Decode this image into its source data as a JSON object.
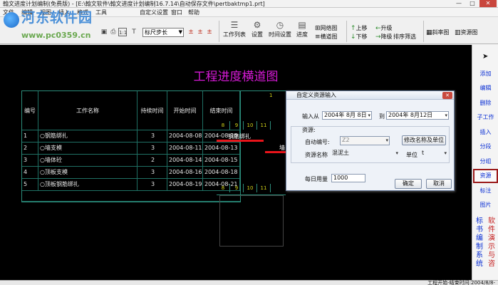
{
  "window": {
    "title": "翰文进度计划编制(免费版) - [E:\\翰文软件\\翰文进度计划编制16.7.14\\自动保存文件\\pertbaktmp1.prt]",
    "minimize_glyph": "—",
    "maximize_glyph": "□",
    "close_glyph": "✕"
  },
  "menu": {
    "items": [
      "文件",
      "编辑",
      "视图",
      "插入",
      "格式",
      "工具",
      "自定义设置",
      "窗口",
      "帮助"
    ]
  },
  "watermark": {
    "name": "河东软件园",
    "url": "www.pc0359.cn"
  },
  "toolbar": {
    "zoom_value": "1:1",
    "ruler_select": "标尺步长",
    "buttons": {
      "work_list": "工作列表",
      "settings": "设置",
      "time_settings": "时间设置",
      "progress": "进度",
      "network_chart": "网络图",
      "bar_chart": "横道图",
      "move_up": "上移",
      "upgrade": "升级",
      "move_down": "下移",
      "downgrade": "降级",
      "sort_filter": "排序筛选",
      "bank_chart": "斜率图",
      "resource_chart": "资源图"
    }
  },
  "chart": {
    "title": "工程进度横道图",
    "columns": [
      "编号",
      "工作名称",
      "持续时间",
      "开始时间",
      "结束时间"
    ],
    "rows": [
      {
        "id": "1",
        "name": "○钢筋绑扎",
        "duration": "3",
        "start": "2004-08-08",
        "end": "2004-08-10"
      },
      {
        "id": "2",
        "name": "○墙支模",
        "duration": "3",
        "start": "2004-08-11",
        "end": "2004-08-13"
      },
      {
        "id": "3",
        "name": "○墙体砼",
        "duration": "2",
        "start": "2004-08-14",
        "end": "2004-08-15"
      },
      {
        "id": "4",
        "name": "○顶板支模",
        "duration": "3",
        "start": "2004-08-16",
        "end": "2004-08-18"
      },
      {
        "id": "5",
        "name": "○顶板钢筋绑扎",
        "duration": "3",
        "start": "2004-08-19",
        "end": "2004-08-21"
      }
    ],
    "timeline_days": [
      "8",
      "9",
      "10",
      "11"
    ],
    "timeline_top_marks": [
      "1"
    ],
    "bar_labels": [
      "钢筋绑扎",
      "墙"
    ]
  },
  "dialog": {
    "title": "自定义资源输入",
    "input_from_label": "输入从",
    "from_date": "2004年 8月 8日",
    "to_label": "到",
    "to_date": "2004年 8月12日",
    "resource_label": "资源:",
    "auto_code_label": "自动编号:",
    "auto_code_value": "Z2",
    "rename_button": "修改名称及单位",
    "resource_name_label": "资源名称",
    "resource_name_value": "混泥土",
    "unit_label": "单位",
    "unit_value": "t",
    "daily_amount_label": "每日用量",
    "daily_amount_value": "1000",
    "ok_button": "确定",
    "cancel_button": "取消"
  },
  "right_panel": {
    "items": [
      "添加",
      "编辑",
      "删除",
      "子工作",
      "插入",
      "分段",
      "分组",
      "资源",
      "标注",
      "图片"
    ],
    "active_item": "资源",
    "vertical_left": "标书编制系统",
    "vertical_right": "软件演示与咨",
    "colors": {
      "left": "#0a2fd4",
      "right": "#c41a1a"
    }
  },
  "statusbar": {
    "text": "工程开始-结束时间:2004/8/8-"
  }
}
